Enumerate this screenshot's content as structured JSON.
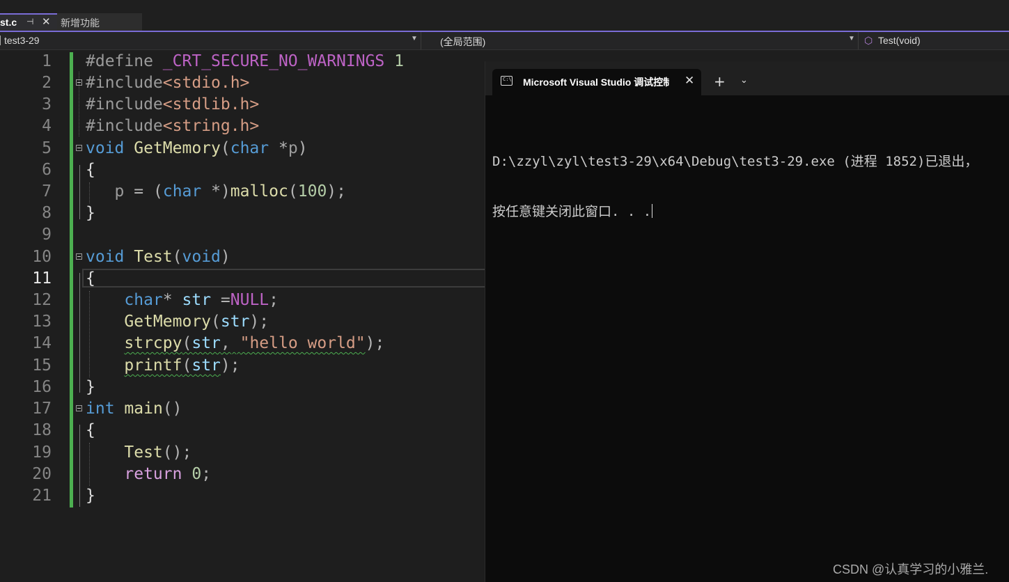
{
  "tabs": {
    "active_label": "st.c",
    "pin_icon": "pin-icon",
    "close_icon": "close-icon",
    "inactive_label": "新增功能"
  },
  "navbar": {
    "project": "test3-29",
    "scope": "(全局范围)",
    "member": "Test(void)"
  },
  "editor": {
    "current_line": 11,
    "line_numbers": [
      "1",
      "2",
      "3",
      "4",
      "5",
      "6",
      "7",
      "8",
      "9",
      "10",
      "11",
      "12",
      "13",
      "14",
      "15",
      "16",
      "17",
      "18",
      "19",
      "20",
      "21"
    ]
  },
  "terminal": {
    "tab_title": "Microsoft Visual Studio 调试控制台",
    "close_label": "✕",
    "new_tab_label": "+",
    "dropdown_label": "⌄",
    "output_line1": "D:\\zzyl\\zyl\\test3-29\\x64\\Debug\\test3-29.exe (进程 1852)已退出，",
    "output_line2": "按任意键关闭此窗口. . ."
  },
  "watermark": "CSDN @认真学习的小雅兰.",
  "colors": {
    "accent": "#7a6cd6",
    "change_bar": "#4caf50",
    "keyword": "#569cd6",
    "string": "#d69d85",
    "function": "#dcdcaa"
  }
}
